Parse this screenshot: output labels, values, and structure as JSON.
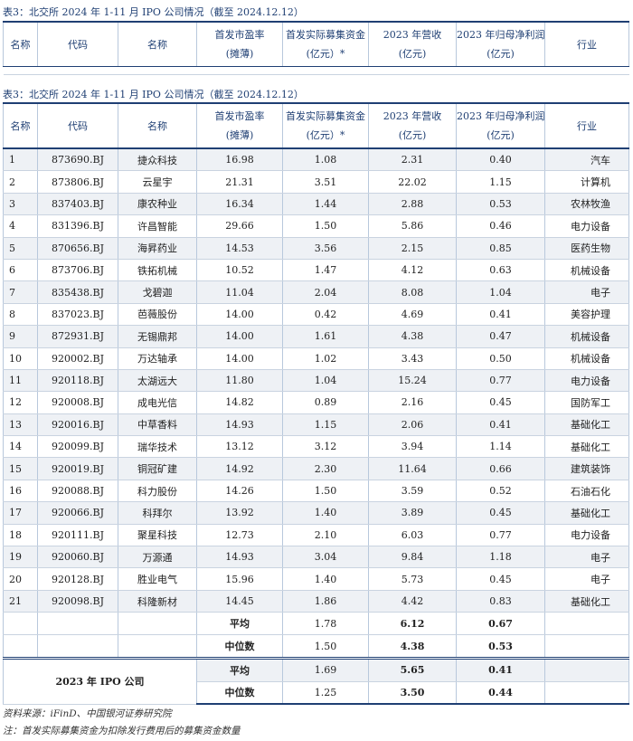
{
  "caption": "表3：北交所 2024 年 1-11 月 IPO 公司情况（截至 2024.12.12）",
  "headers": {
    "idx": "名称",
    "code": "代码",
    "name": "名称",
    "pe_1": "首发市盈率",
    "pe_2": "(摊薄)",
    "raise_1": "首发实际募集资金",
    "raise_2": "(亿元）*",
    "rev_1": "2023 年营收",
    "rev_2": "(亿元)",
    "np_1": "2023 年归母净利润",
    "np_2": "(亿元)",
    "industry": "行业"
  },
  "rows": [
    {
      "idx": "1",
      "code": "873690.BJ",
      "name": "捷众科技",
      "pe": "16.98",
      "raise": "1.08",
      "rev": "2.31",
      "np": "0.40",
      "industry": "汽车"
    },
    {
      "idx": "2",
      "code": "873806.BJ",
      "name": "云星宇",
      "pe": "21.31",
      "raise": "3.51",
      "rev": "22.02",
      "np": "1.15",
      "industry": "计算机"
    },
    {
      "idx": "3",
      "code": "837403.BJ",
      "name": "康农种业",
      "pe": "16.34",
      "raise": "1.44",
      "rev": "2.88",
      "np": "0.53",
      "industry": "农林牧渔"
    },
    {
      "idx": "4",
      "code": "831396.BJ",
      "name": "许昌智能",
      "pe": "29.66",
      "raise": "1.50",
      "rev": "5.86",
      "np": "0.46",
      "industry": "电力设备"
    },
    {
      "idx": "5",
      "code": "870656.BJ",
      "name": "海昇药业",
      "pe": "14.53",
      "raise": "3.56",
      "rev": "2.15",
      "np": "0.85",
      "industry": "医药生物"
    },
    {
      "idx": "6",
      "code": "873706.BJ",
      "name": "铁拓机械",
      "pe": "10.52",
      "raise": "1.47",
      "rev": "4.12",
      "np": "0.63",
      "industry": "机械设备"
    },
    {
      "idx": "7",
      "code": "835438.BJ",
      "name": "戈碧迦",
      "pe": "11.04",
      "raise": "2.04",
      "rev": "8.08",
      "np": "1.04",
      "industry": "电子"
    },
    {
      "idx": "8",
      "code": "837023.BJ",
      "name": "芭薇股份",
      "pe": "14.00",
      "raise": "0.42",
      "rev": "4.69",
      "np": "0.41",
      "industry": "美容护理"
    },
    {
      "idx": "9",
      "code": "872931.BJ",
      "name": "无锡鼎邦",
      "pe": "14.00",
      "raise": "1.61",
      "rev": "4.38",
      "np": "0.47",
      "industry": "机械设备"
    },
    {
      "idx": "10",
      "code": "920002.BJ",
      "name": "万达轴承",
      "pe": "14.00",
      "raise": "1.02",
      "rev": "3.43",
      "np": "0.50",
      "industry": "机械设备"
    },
    {
      "idx": "11",
      "code": "920118.BJ",
      "name": "太湖远大",
      "pe": "11.80",
      "raise": "1.04",
      "rev": "15.24",
      "np": "0.77",
      "industry": "电力设备"
    },
    {
      "idx": "12",
      "code": "920008.BJ",
      "name": "成电光信",
      "pe": "14.82",
      "raise": "0.89",
      "rev": "2.16",
      "np": "0.45",
      "industry": "国防军工"
    },
    {
      "idx": "13",
      "code": "920016.BJ",
      "name": "中草香料",
      "pe": "14.93",
      "raise": "1.15",
      "rev": "2.06",
      "np": "0.41",
      "industry": "基础化工"
    },
    {
      "idx": "14",
      "code": "920099.BJ",
      "name": "瑞华技术",
      "pe": "13.12",
      "raise": "3.12",
      "rev": "3.94",
      "np": "1.14",
      "industry": "基础化工"
    },
    {
      "idx": "15",
      "code": "920019.BJ",
      "name": "铜冠矿建",
      "pe": "14.92",
      "raise": "2.30",
      "rev": "11.64",
      "np": "0.66",
      "industry": "建筑装饰"
    },
    {
      "idx": "16",
      "code": "920088.BJ",
      "name": "科力股份",
      "pe": "14.26",
      "raise": "1.50",
      "rev": "3.59",
      "np": "0.52",
      "industry": "石油石化"
    },
    {
      "idx": "17",
      "code": "920066.BJ",
      "name": "科拜尔",
      "pe": "13.92",
      "raise": "1.40",
      "rev": "3.89",
      "np": "0.45",
      "industry": "基础化工"
    },
    {
      "idx": "18",
      "code": "920111.BJ",
      "name": "聚星科技",
      "pe": "12.73",
      "raise": "2.10",
      "rev": "6.03",
      "np": "0.77",
      "industry": "电力设备"
    },
    {
      "idx": "19",
      "code": "920060.BJ",
      "name": "万源通",
      "pe": "14.93",
      "raise": "3.04",
      "rev": "9.84",
      "np": "1.18",
      "industry": "电子"
    },
    {
      "idx": "20",
      "code": "920128.BJ",
      "name": "胜业电气",
      "pe": "15.96",
      "raise": "1.40",
      "rev": "5.73",
      "np": "0.45",
      "industry": "电子"
    },
    {
      "idx": "21",
      "code": "920098.BJ",
      "name": "科隆新材",
      "pe": "14.45",
      "raise": "1.86",
      "rev": "4.42",
      "np": "0.83",
      "industry": "基础化工"
    }
  ],
  "summary_2024": [
    {
      "label": "平均",
      "raise": "1.78",
      "rev": "6.12",
      "np": "0.67"
    },
    {
      "label": "中位数",
      "raise": "1.50",
      "rev": "4.38",
      "np": "0.53"
    }
  ],
  "summary_2023": {
    "group_label": "2023 年 IPO 公司",
    "rows": [
      {
        "label": "平均",
        "raise": "1.69",
        "rev": "5.65",
        "np": "0.41"
      },
      {
        "label": "中位数",
        "raise": "1.25",
        "rev": "3.50",
        "np": "0.44"
      }
    ]
  },
  "source": "资料来源：iFinD、中国银河证券研究院",
  "note": "注：首发实际募集资金为扣除发行费用后的募集资金数量",
  "colors": {
    "accent": "#1f3f73",
    "stripe": "#eef1f5",
    "rule": "#c9d3e0"
  }
}
